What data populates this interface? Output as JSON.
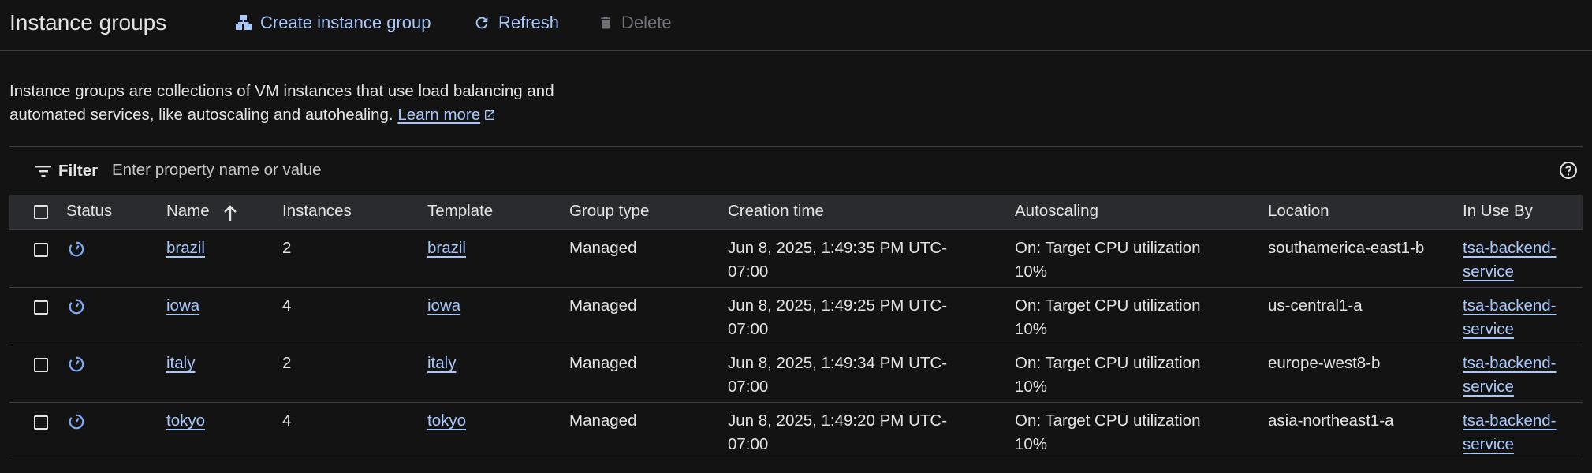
{
  "header": {
    "title": "Instance groups",
    "create_label": "Create instance group",
    "refresh_label": "Refresh",
    "delete_label": "Delete"
  },
  "description": {
    "text": "Instance groups are collections of VM instances that use load balancing and automated services, like autoscaling and autohealing.",
    "learn_more": "Learn more"
  },
  "filter": {
    "label": "Filter",
    "placeholder": "Enter property name or value"
  },
  "table": {
    "columns": {
      "status": "Status",
      "name": "Name",
      "instances": "Instances",
      "template": "Template",
      "group_type": "Group type",
      "creation_time": "Creation time",
      "autoscaling": "Autoscaling",
      "location": "Location",
      "in_use_by": "In Use By"
    },
    "sort": {
      "column": "Name",
      "direction": "ascending"
    },
    "rows": [
      {
        "name": "brazil",
        "instances": "2",
        "template": "brazil",
        "group_type": "Managed",
        "creation_time": "Jun 8, 2025, 1:49:35 PM UTC-07:00",
        "autoscaling": "On: Target CPU utilization 10%",
        "location": "southamerica-east1-b",
        "in_use_by": "tsa-backend-service"
      },
      {
        "name": "iowa",
        "instances": "4",
        "template": "iowa",
        "group_type": "Managed",
        "creation_time": "Jun 8, 2025, 1:49:25 PM UTC-07:00",
        "autoscaling": "On: Target CPU utilization 10%",
        "location": "us-central1-a",
        "in_use_by": "tsa-backend-service"
      },
      {
        "name": "italy",
        "instances": "2",
        "template": "italy",
        "group_type": "Managed",
        "creation_time": "Jun 8, 2025, 1:49:34 PM UTC-07:00",
        "autoscaling": "On: Target CPU utilization 10%",
        "location": "europe-west8-b",
        "in_use_by": "tsa-backend-service"
      },
      {
        "name": "tokyo",
        "instances": "4",
        "template": "tokyo",
        "group_type": "Managed",
        "creation_time": "Jun 8, 2025, 1:49:20 PM UTC-07:00",
        "autoscaling": "On: Target CPU utilization 10%",
        "location": "asia-northeast1-a",
        "in_use_by": "tsa-backend-service"
      }
    ]
  },
  "icons": {
    "create": "instance-group-icon",
    "refresh": "refresh-icon",
    "delete": "trash-icon",
    "filter": "filter-icon",
    "help": "help-icon",
    "status": "status-updating-icon",
    "sort": "arrow-up-icon",
    "external_link": "external-link-icon"
  },
  "colors": {
    "background": "#131314",
    "link": "#a8c7fa",
    "status_icon": "#7cacf8",
    "header_row": "#2a2b2e",
    "disabled": "#6f7378"
  }
}
